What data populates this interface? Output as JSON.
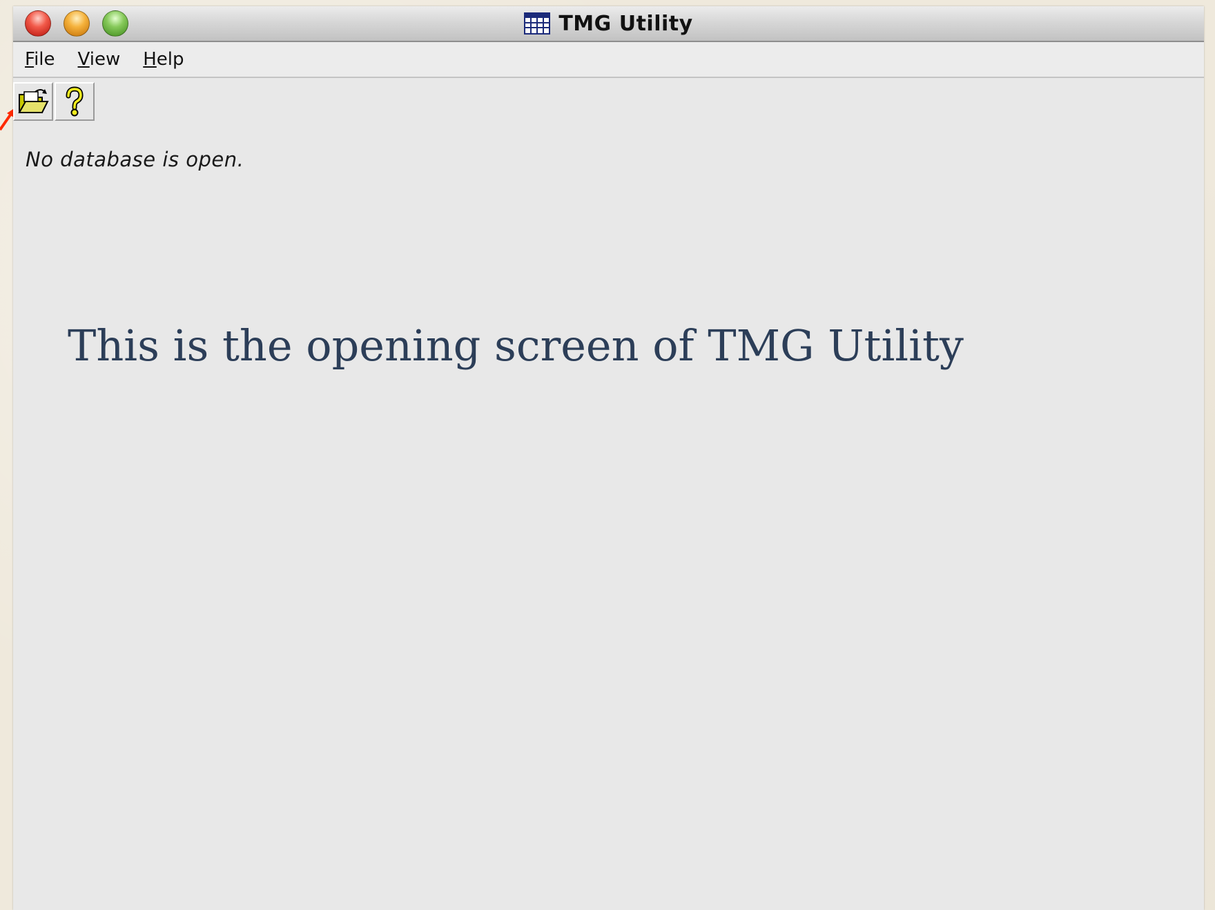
{
  "window": {
    "title": "TMG Utility"
  },
  "menu": {
    "items": [
      {
        "label": "File",
        "mnemonic": "F",
        "rest": "ile"
      },
      {
        "label": "View",
        "mnemonic": "V",
        "rest": "iew"
      },
      {
        "label": "Help",
        "mnemonic": "H",
        "rest": "elp"
      }
    ]
  },
  "toolbar": {
    "buttons": [
      {
        "name": "open",
        "icon": "open-folder-icon"
      },
      {
        "name": "help",
        "icon": "question-mark-icon"
      }
    ]
  },
  "status": {
    "message": "No database is open."
  },
  "caption": {
    "text": "This is the opening screen of TMG Utility"
  },
  "colors": {
    "caption": "#2c3e58",
    "annotation_arrow": "#ff2a00",
    "window_background": "#e8e8e8"
  }
}
